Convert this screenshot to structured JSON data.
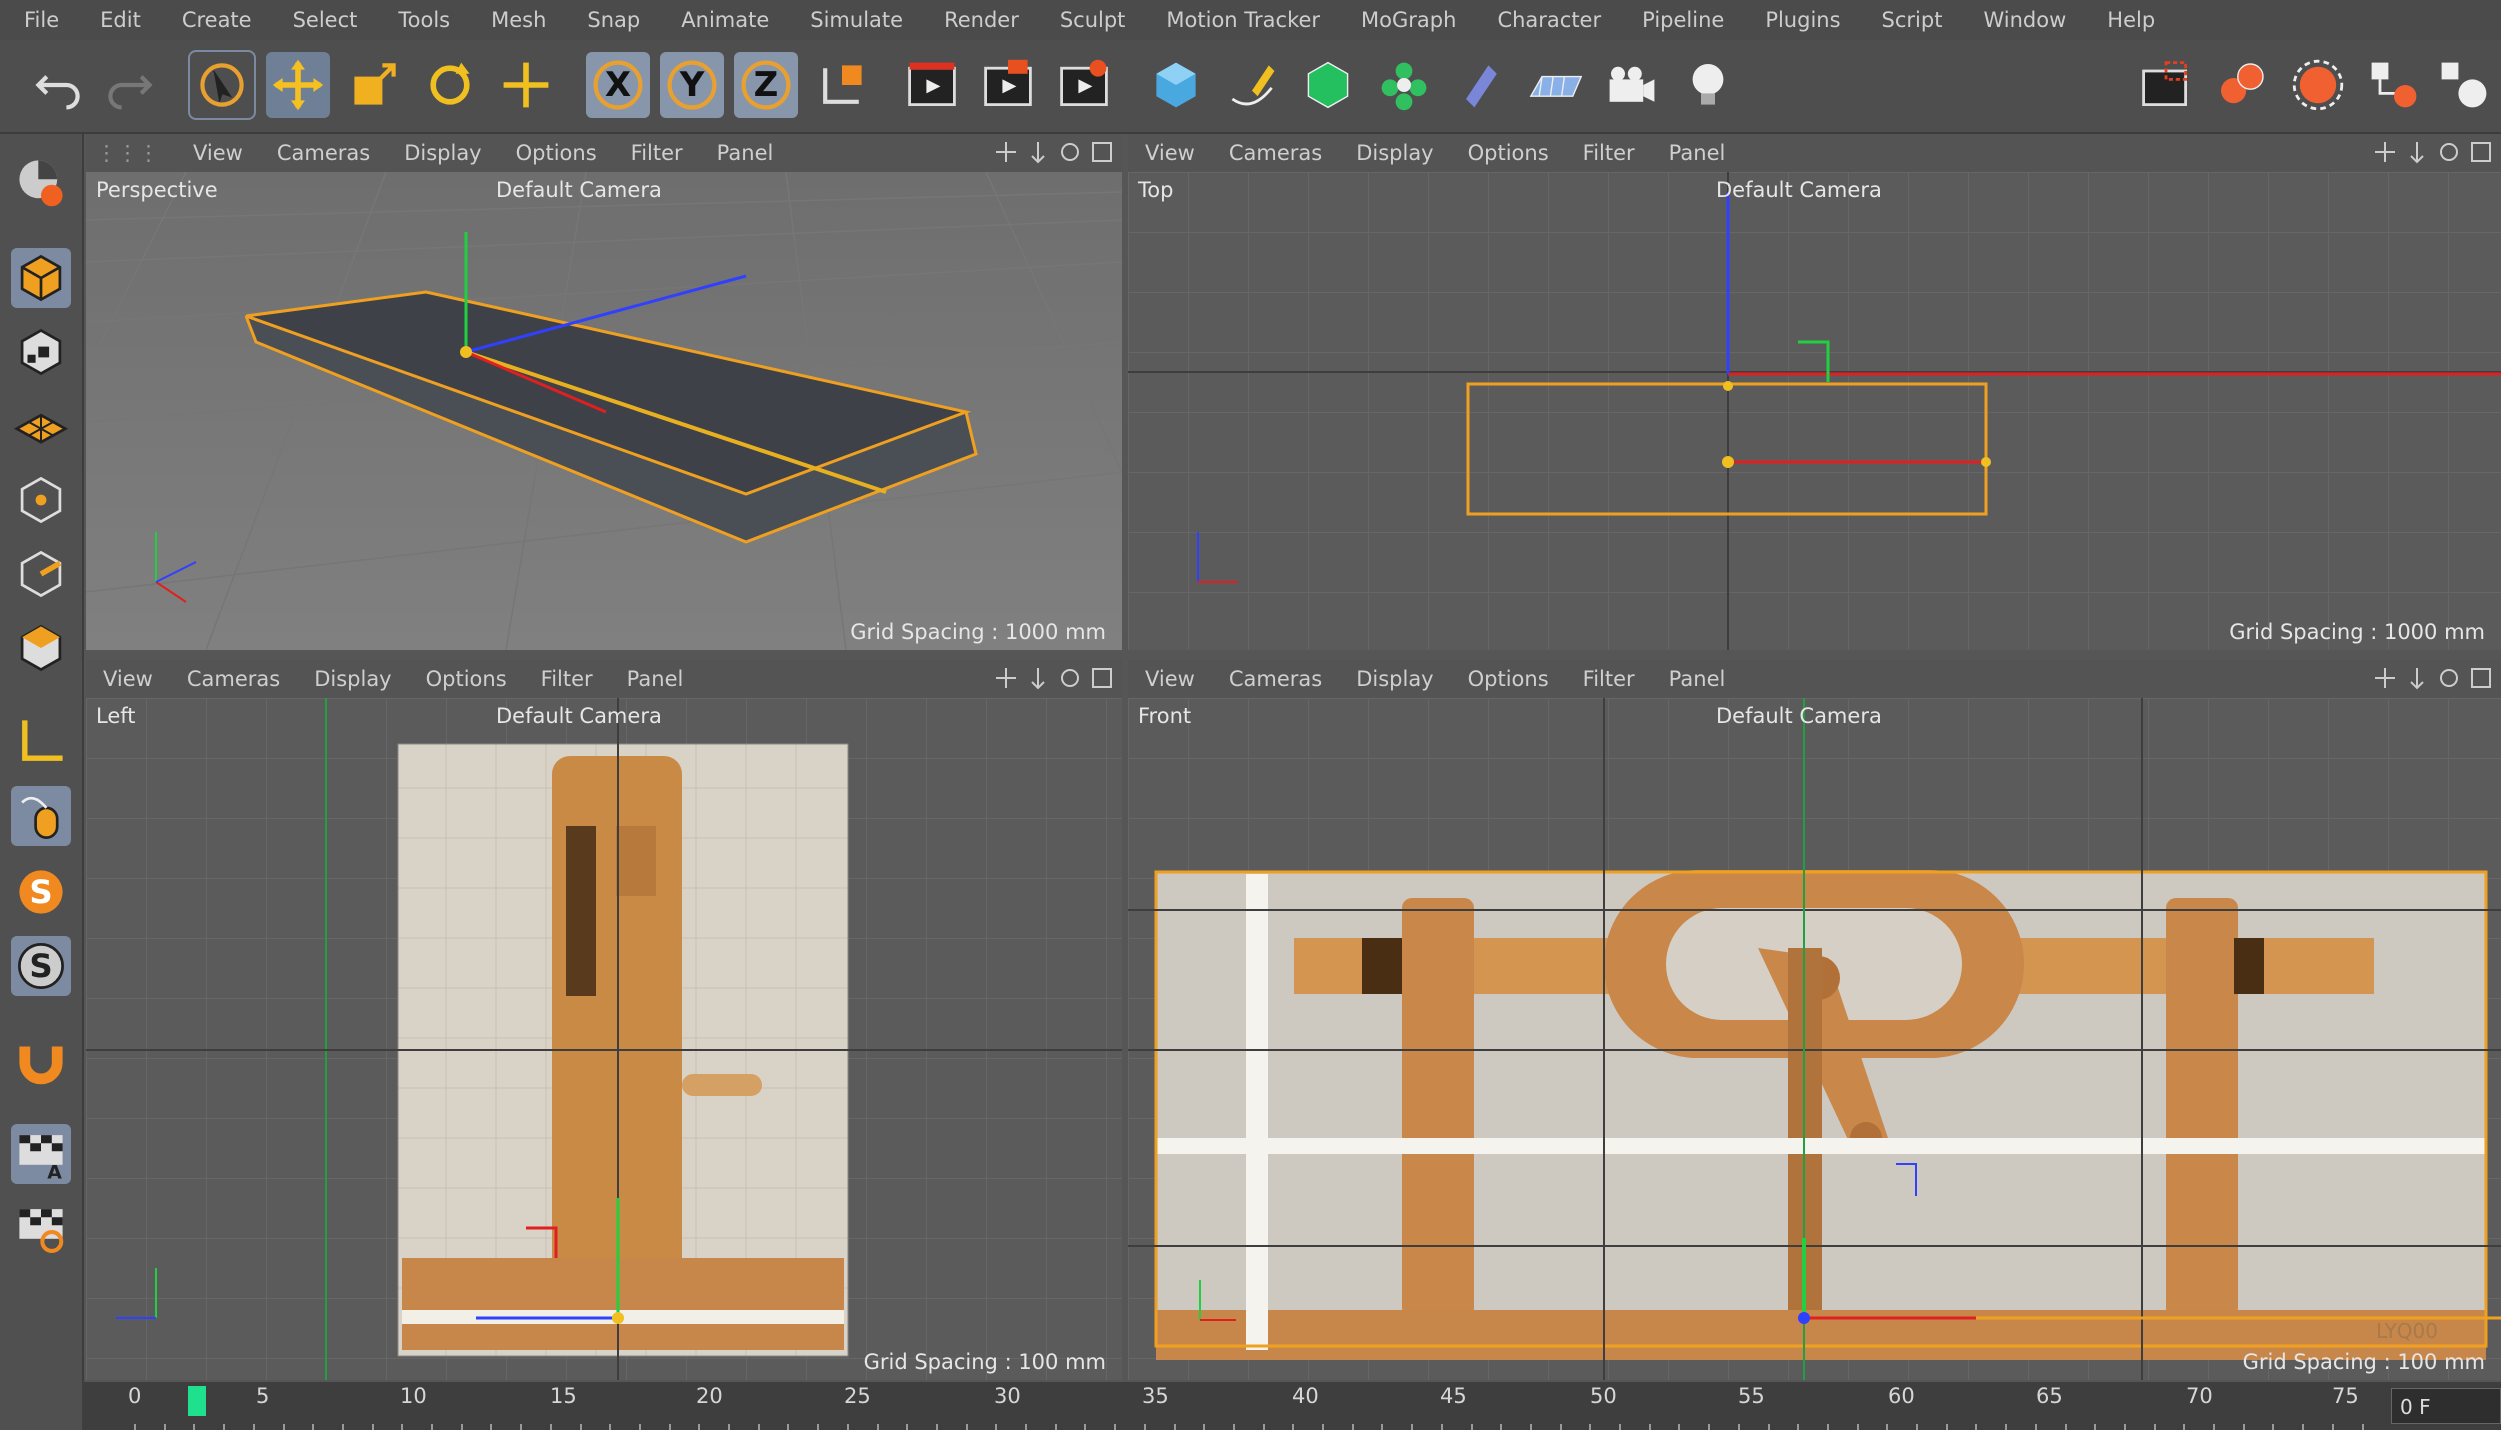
{
  "menu": [
    "File",
    "Edit",
    "Create",
    "Select",
    "Tools",
    "Mesh",
    "Snap",
    "Animate",
    "Simulate",
    "Render",
    "Sculpt",
    "Motion Tracker",
    "MoGraph",
    "Character",
    "Pipeline",
    "Plugins",
    "Script",
    "Window",
    "Help"
  ],
  "toolbar": {
    "undo": "undo-icon",
    "redo": "redo-icon",
    "axis_x": "X",
    "axis_y": "Y",
    "axis_z": "Z"
  },
  "viewports": {
    "menu": [
      "View",
      "Cameras",
      "Display",
      "Options",
      "Filter",
      "Panel"
    ],
    "camera": "Default Camera",
    "perspective": {
      "name": "Perspective",
      "grid": "Grid Spacing : 1000 mm"
    },
    "top": {
      "name": "Top",
      "grid": "Grid Spacing : 1000 mm"
    },
    "left": {
      "name": "Left",
      "grid": "Grid Spacing : 100 mm"
    },
    "front": {
      "name": "Front",
      "grid": "Grid Spacing : 100 mm"
    }
  },
  "axes": {
    "x": "X",
    "y": "Y",
    "z": "Z"
  },
  "front_watermark": "LYQ00",
  "timeline": {
    "ticks": [
      "0",
      "5",
      "10",
      "15",
      "20",
      "25",
      "30",
      "35",
      "40",
      "45",
      "50",
      "55",
      "60",
      "65",
      "70",
      "75"
    ],
    "current_frame": "0 F"
  },
  "colors": {
    "selection": "#f0a020",
    "x_axis": "#e02020",
    "y_axis": "#20d040",
    "z_axis": "#3040ff",
    "playhead": "#1fe08c"
  }
}
